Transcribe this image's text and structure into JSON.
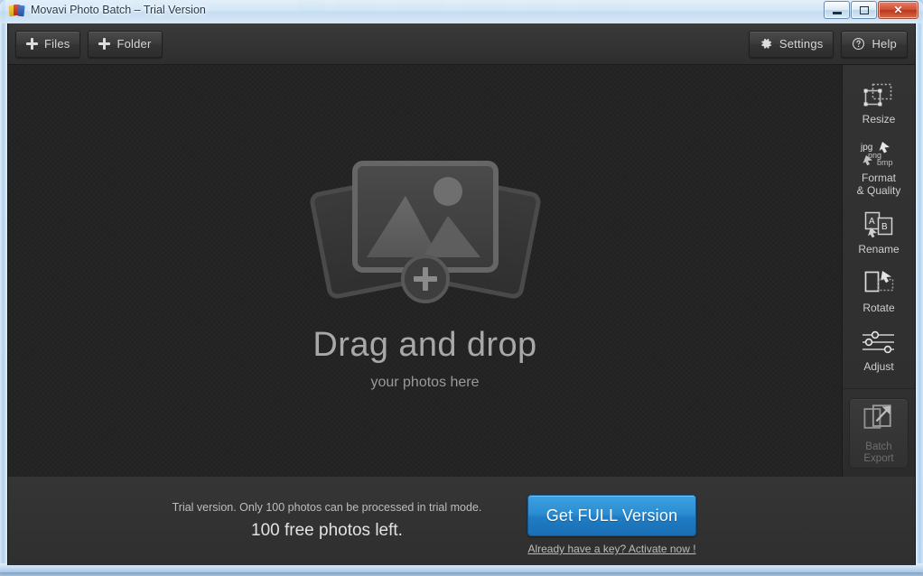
{
  "window": {
    "title": "Movavi Photo Batch – Trial Version",
    "app_icon": "movavi-app-icon",
    "controls": {
      "minimize": "minimize-button",
      "maximize": "maximize-button",
      "close": "close-button",
      "close_glyph": "✕"
    }
  },
  "toolbar": {
    "files_label": "Files",
    "folder_label": "Folder",
    "settings_label": "Settings",
    "help_label": "Help",
    "files_icon": "plus-icon",
    "folder_icon": "plus-icon",
    "settings_icon": "gear-icon",
    "help_icon": "question-circle-icon"
  },
  "canvas": {
    "drop_title": "Drag and drop",
    "drop_subtitle": "your photos here",
    "placeholder_icon": "photo-stack-add-icon",
    "add_badge": "+"
  },
  "sidebar": {
    "tools": [
      {
        "label": "Resize",
        "icon": "resize-icon"
      },
      {
        "label": "Format\n& Quality",
        "label_line1": "Format",
        "label_line2": "& Quality",
        "icon": "format-quality-icon",
        "formats": [
          "jpg",
          "png",
          "bmp"
        ]
      },
      {
        "label": "Rename",
        "icon": "rename-icon",
        "page_a": "A",
        "page_b": "B"
      },
      {
        "label": "Rotate",
        "icon": "rotate-icon"
      },
      {
        "label": "Adjust",
        "icon": "adjust-sliders-icon"
      }
    ],
    "batch_export": {
      "line1": "Batch",
      "line2": "Export",
      "icon": "export-arrow-icon",
      "enabled": false
    }
  },
  "bottom": {
    "trial_notice": "Trial version. Only 100 photos can be processed in trial mode.",
    "free_photos": "100 free photos left.",
    "get_full_label": "Get FULL Version",
    "activate_link": "Already have a key? Activate now !"
  },
  "colors": {
    "accent_blue": "#2b8ed3",
    "canvas_bg": "#242424",
    "chrome_bg": "#2e2e2e",
    "text_primary": "#d6d6d6",
    "text_muted": "#6e6e6e"
  }
}
